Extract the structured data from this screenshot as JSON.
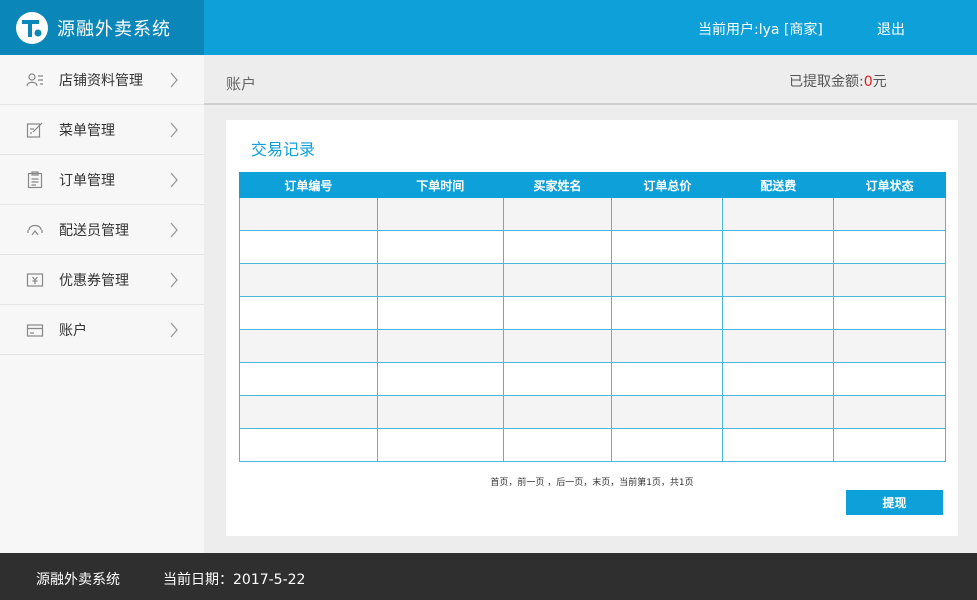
{
  "header": {
    "brand": "源融外卖系统",
    "user_label": "当前用户:lya [商家]",
    "logout": "退出"
  },
  "sidebar": {
    "items": [
      {
        "label": "店铺资料管理",
        "icon": "store-profile-icon"
      },
      {
        "label": "菜单管理",
        "icon": "menu-edit-icon"
      },
      {
        "label": "订单管理",
        "icon": "order-clipboard-icon"
      },
      {
        "label": "配送员管理",
        "icon": "courier-icon"
      },
      {
        "label": "优惠券管理",
        "icon": "coupon-icon"
      },
      {
        "label": "账户",
        "icon": "card-icon"
      }
    ]
  },
  "main": {
    "title": "账户",
    "withdrawn_label": "已提取金额:",
    "withdrawn_amount": "0",
    "withdrawn_unit": "元"
  },
  "panel": {
    "title": "交易记录",
    "columns": [
      "订单编号",
      "下单时间",
      "买家姓名",
      "订单总价",
      "配送费",
      "订单状态"
    ],
    "pager": "首页，前一页 ，后一页，末页，当前第1页，共1页",
    "withdraw_button": "提现"
  },
  "footer": {
    "brand": "源融外卖系统",
    "date": "当前日期：2017-5-22"
  },
  "colors": {
    "accent": "#0ea0d9",
    "brand_dark": "#0b86b9",
    "footer": "#2f2f2f",
    "amount": "#e02020"
  }
}
